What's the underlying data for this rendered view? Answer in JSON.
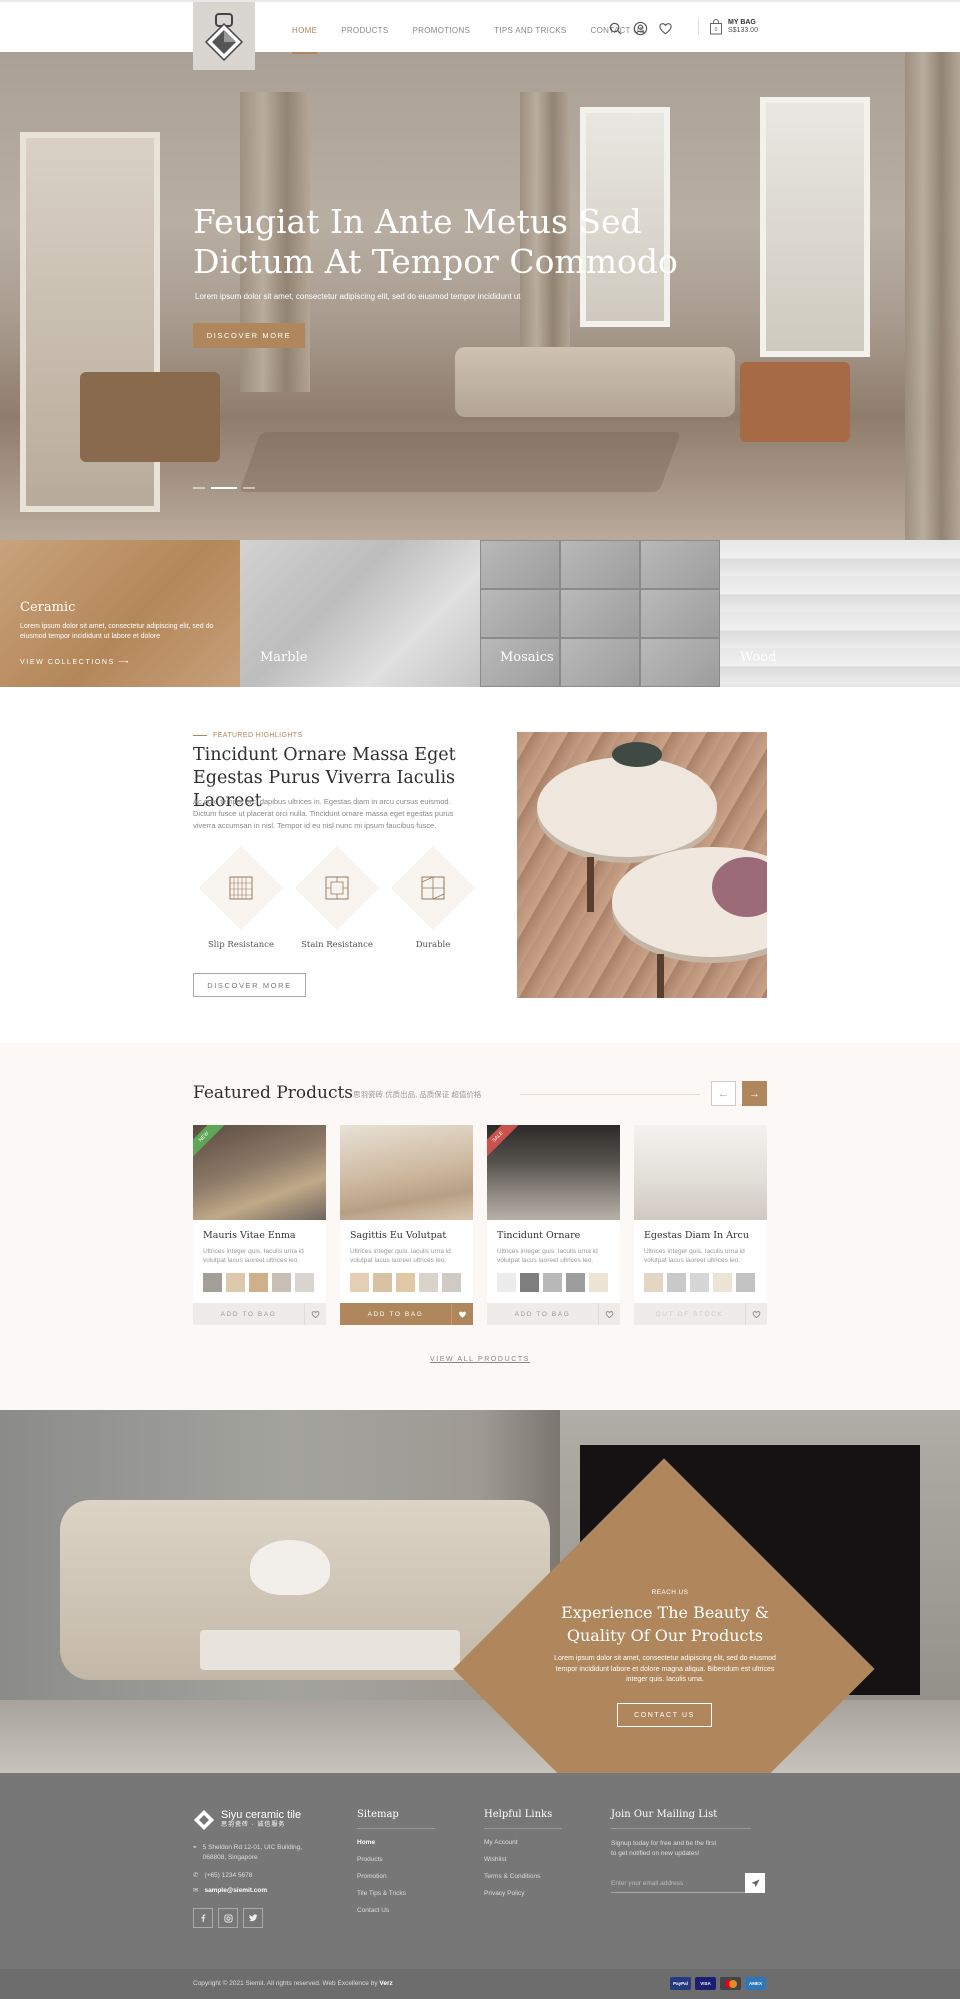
{
  "header": {
    "nav": [
      "HOME",
      "PRODUCTS",
      "PROMOTIONS",
      "TIPS AND TRICKS",
      "CONTACT US"
    ],
    "bag_label": "MY BAG",
    "bag_amount": "S$133.00"
  },
  "hero": {
    "title": "Feugiat In Ante Metus Sed Dictum At Tempor Commodo",
    "text": "Lorem ipsum dolor sit amet, consectetur adipiscing elit, sed do eiusmod tempor incididunt ut",
    "button": "DISCOVER MORE",
    "slides": 3,
    "active_slide": 2
  },
  "categories": [
    {
      "name": "Ceramic",
      "desc": "Lorem ipsum dolor sit amet, consectetur adipiscing elit, sed do eiusmod tempor incididunt ut labore et dolore",
      "link": "VIEW COLLECTIONS"
    },
    {
      "name": "Marble"
    },
    {
      "name": "Mosaics"
    },
    {
      "name": "Wood"
    }
  ],
  "highlights": {
    "eyebrow": "FEATURED HIGHLIGHTS",
    "title": "Tincidunt Ornare Massa Eget Egestas Purus Viverra Iaculis Laoreet",
    "text": "Ac odio tempor orci dapibus ultrices in. Egestas diam in arcu cursus euismod. Dictum fusce ut placerat orci nulla. Tincidunt ornare massa eget egestas purus viverra accumsan in nisl. Tempor id eu nisl nunc mi ipsum faucibus fusce.",
    "features": [
      "Slip Resistance",
      "Stain Resistance",
      "Durable"
    ],
    "button": "DISCOVER MORE"
  },
  "featured": {
    "title": "Featured Products",
    "subtitle": "思羽瓷砖 优质出品, 品质保证 超值价格",
    "view_all": "VIEW ALL PRODUCTS",
    "products": [
      {
        "name": "Mauris Vitae Enma",
        "desc": "Ultrices integer quis. Iaculis urna id volutpat lacus laoreet ultrices leo.",
        "action": "ADD TO BAG",
        "ribbon": "NEW",
        "ribbon_color": "#5fa55a",
        "swatches": [
          "#a39e98",
          "#dcc8ad",
          "#cfb08c",
          "#c8beb3",
          "#d9d6d2"
        ]
      },
      {
        "name": "Sagittis Eu Volutpat",
        "desc": "Ultrices integer quis. Iaculis urna id volutpat lacus laoreet ultrices leo.",
        "action": "ADD TO BAG",
        "ribbon": "",
        "ribbon_color": "",
        "swatches": [
          "#e4cfb5",
          "#d9c2a4",
          "#e0c7a5",
          "#dad3ca",
          "#cfcac4"
        ]
      },
      {
        "name": "Tincidunt Ornare",
        "desc": "Ultrices integer quis. Iaculis urna id volutpat lacus laoreet ultrices leo.",
        "action": "ADD TO BAG",
        "ribbon": "SALE",
        "ribbon_color": "#c9524c",
        "swatches": [
          "#ececec",
          "#7e7e7e",
          "#b9b9b9",
          "#9d9d9d",
          "#ede4d5"
        ]
      },
      {
        "name": "Egestas Diam In Arcu",
        "desc": "Ultrices integer quis. Iaculis urna id volutpat lacus laoreet ultrices leo.",
        "action": "OUT OF STOCK",
        "ribbon": "",
        "ribbon_color": "",
        "swatches": [
          "#e3d6c4",
          "#c9c9c9",
          "#d6d6d6",
          "#eee4d6",
          "#c3c3c3"
        ]
      }
    ]
  },
  "banner": {
    "eyebrow": "REACH US",
    "title": "Experience The Beauty & Quality Of Our Products",
    "text": "Lorem ipsum dolor sit amet, consectetur adipiscing elit, sed do eiusmod tempor incididunt labore et dolore magna aliqua. Bibendum est ultrices integer quis. Iaculis urna.",
    "button": "CONTACT US"
  },
  "footer": {
    "brand": "Siyu ceramic tile",
    "brand_cn": "思羽瓷砖 · 诚信服务",
    "address": "5 Sheldon Rd 12-01, UIC Building, 068808, Singapore",
    "phone": "(+65) 1234 5678",
    "email": "sample@siemit.com",
    "sitemap_title": "Sitemap",
    "sitemap": [
      "Home",
      "Products",
      "Promotion",
      "Tile Tips & Tricks",
      "Contact Us"
    ],
    "links_title": "Helpful Links",
    "links": [
      "My Account",
      "Wishlist",
      "Terms & Conditions",
      "Privacy Policy"
    ],
    "mail_title": "Join Our Mailing List",
    "mail_text": "Signup today for free and be the first to get notified on new updates!",
    "mail_placeholder": "Enter your email address",
    "copyright": "Copyright © 2021 Siemit. All rights reserved. Web Excellence by",
    "credit": "Verz",
    "payments": [
      "PayPal",
      "VISA",
      "MC",
      "AMEX"
    ]
  },
  "colors": {
    "accent": "#b0865c",
    "footer": "#777777"
  }
}
